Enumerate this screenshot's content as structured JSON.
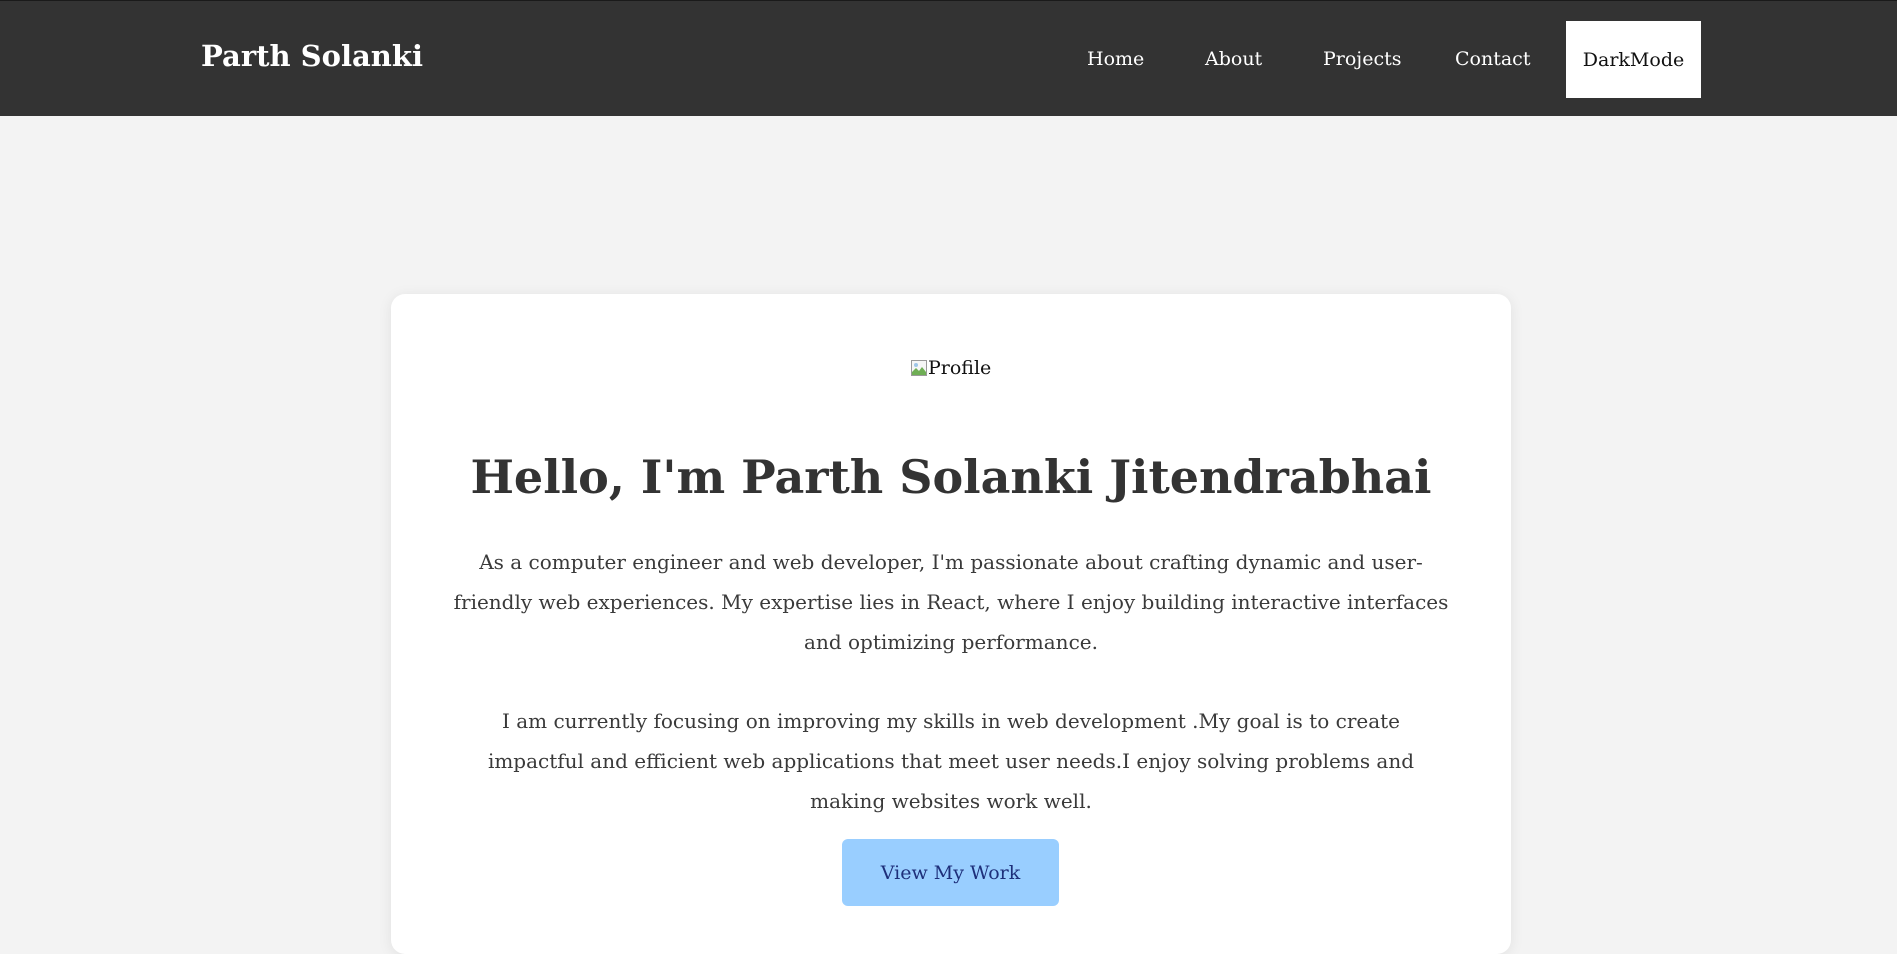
{
  "navbar": {
    "brand": "Parth Solanki",
    "links": [
      "Home",
      "About",
      "Projects",
      "Contact"
    ],
    "dark_mode_label": "DarkMode"
  },
  "hero": {
    "profile_alt": "Profile",
    "headline": "Hello, I'm Parth Solanki Jitendrabhai",
    "paragraph_1": "As a computer engineer and web developer, I'm passionate about crafting dynamic and user-friendly web experiences. My expertise lies in React, where I enjoy building interactive interfaces and optimizing performance.",
    "paragraph_2": "I am currently focusing on improving my skills in web development .My goal is to create impactful and efficient web applications that meet user needs.I enjoy solving problems and making websites work well.",
    "cta_label": "View My Work"
  },
  "colors": {
    "navbar_bg": "#333333",
    "page_bg": "#f3f3f3",
    "card_bg": "#ffffff",
    "cta_bg": "#99ceff",
    "cta_text": "#1e2f7a",
    "headline": "#333333"
  }
}
